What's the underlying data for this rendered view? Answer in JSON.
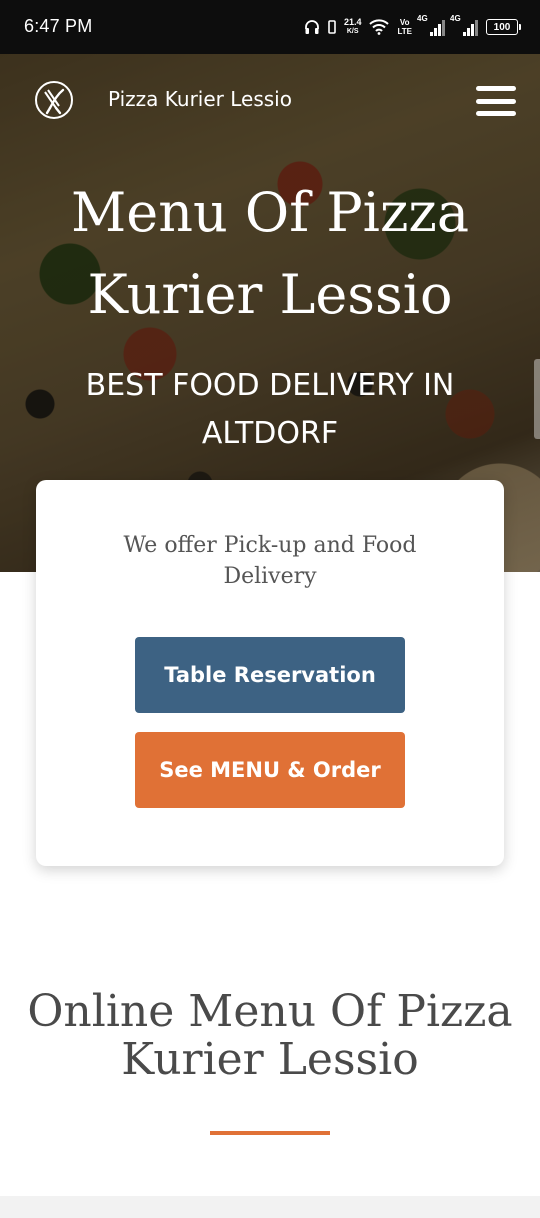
{
  "status_bar": {
    "time": "6:47 PM",
    "net_speed_value": "21.4",
    "net_speed_unit": "K/S",
    "volte_top": "Vo",
    "volte_bottom": "LTE",
    "sim1_type": "4G",
    "sim2_type": "4G",
    "battery_level": "100",
    "icons": [
      "headphones-icon",
      "vibrate-icon",
      "wifi-icon",
      "signal-icon",
      "battery-icon"
    ]
  },
  "header": {
    "brand": "Pizza Kurier Lessio",
    "logo_icon": "fork-knife-icon",
    "menu_icon": "hamburger-menu-icon"
  },
  "hero": {
    "title_line1": "Menu Of Pizza",
    "title_line2": "Kurier Lessio",
    "subtitle_line1": "BEST FOOD DELIVERY IN",
    "subtitle_line2": "ALTDORF"
  },
  "card": {
    "text": "We offer Pick-up and Food Delivery",
    "reserve_label": "Table Reservation",
    "order_label": "See MENU & Order"
  },
  "section": {
    "title_line1": "Online Menu Of Pizza",
    "title_line2": "Kurier Lessio"
  },
  "colors": {
    "reserve_button": "#3d6283",
    "order_button": "#e07136",
    "accent": "#e07136",
    "status_bar": "#0d0d0d"
  }
}
